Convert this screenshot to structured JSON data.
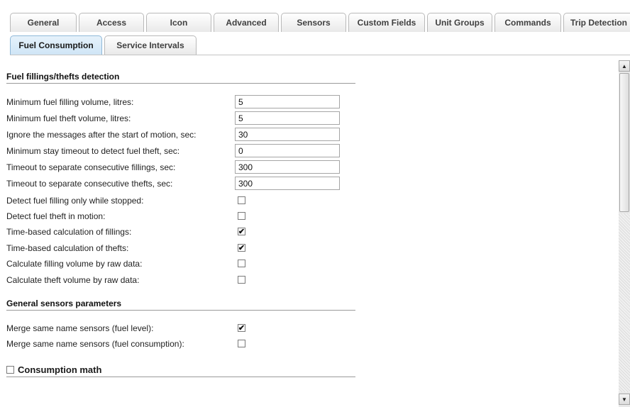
{
  "tabs_row1": [
    "General",
    "Access",
    "Icon",
    "Advanced",
    "Sensors",
    "Custom Fields",
    "Unit Groups",
    "Commands",
    "Trip Detection"
  ],
  "tabs_row2": [
    "Fuel Consumption",
    "Service Intervals"
  ],
  "active_tab": "Fuel Consumption",
  "sections": {
    "fuel_fillings": {
      "title": "Fuel fillings/thefts detection",
      "min_fill_volume": {
        "label": "Minimum fuel filling volume, litres:",
        "value": "5"
      },
      "min_theft_volume": {
        "label": "Minimum fuel theft volume, litres:",
        "value": "5"
      },
      "ignore_after_motion": {
        "label": "Ignore the messages after the start of motion, sec:",
        "value": "30"
      },
      "min_stay_timeout": {
        "label": "Minimum stay timeout to detect fuel theft, sec:",
        "value": "0"
      },
      "timeout_fillings": {
        "label": "Timeout to separate consecutive fillings, sec:",
        "value": "300"
      },
      "timeout_thefts": {
        "label": "Timeout to separate consecutive thefts, sec:",
        "value": "300"
      },
      "detect_fill_stopped": {
        "label": "Detect fuel filling only while stopped:",
        "checked": false
      },
      "detect_theft_motion": {
        "label": "Detect fuel theft in motion:",
        "checked": false
      },
      "time_calc_fillings": {
        "label": "Time-based calculation of fillings:",
        "checked": true
      },
      "time_calc_thefts": {
        "label": "Time-based calculation of thefts:",
        "checked": true
      },
      "calc_fill_raw": {
        "label": "Calculate filling volume by raw data:",
        "checked": false
      },
      "calc_theft_raw": {
        "label": "Calculate theft volume by raw data:",
        "checked": false
      }
    },
    "general_sensors": {
      "title": "General sensors parameters",
      "merge_fuel_level": {
        "label": "Merge same name sensors (fuel level):",
        "checked": true
      },
      "merge_fuel_consumption": {
        "label": "Merge same name sensors (fuel consumption):",
        "checked": false
      }
    },
    "consumption_math": {
      "label": "Consumption math",
      "checked": false
    }
  },
  "icons": {
    "scroll_up": "scroll-up-arrow-icon",
    "scroll_down": "scroll-down-arrow-icon",
    "checkmark": "checkmark-icon"
  },
  "colors": {
    "active_tab_bg": "#cfe5f6",
    "tab_bg": "#e9e9e9",
    "border": "#b9b9b9"
  }
}
